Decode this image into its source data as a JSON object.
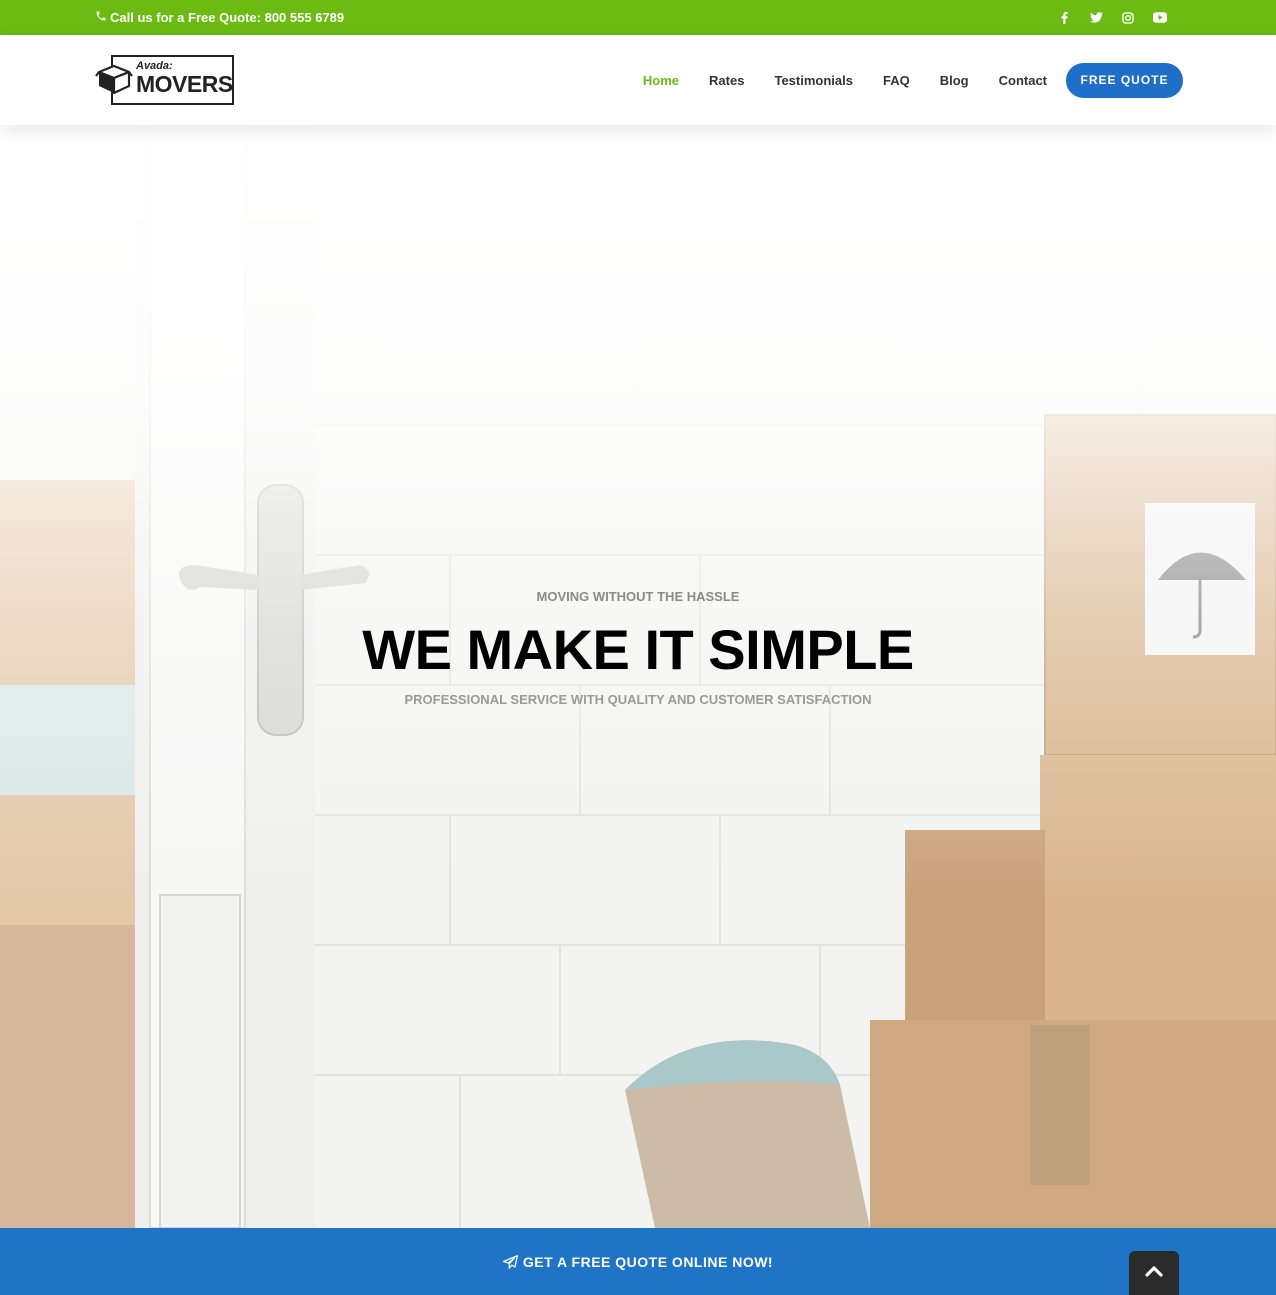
{
  "topbar": {
    "phone_text": "Call us for a Free Quote: 800 555 6789",
    "phone_icon": "phone-icon",
    "social": [
      "facebook-icon",
      "twitter-icon",
      "instagram-icon",
      "youtube-icon"
    ],
    "bg_color": "#6cbb13"
  },
  "logo": {
    "small": "Avada:",
    "big": "MOVERS",
    "icon": "box-icon"
  },
  "nav": {
    "items": [
      {
        "label": "Home",
        "active": true
      },
      {
        "label": "Rates"
      },
      {
        "label": "Testimonials"
      },
      {
        "label": "FAQ"
      },
      {
        "label": "Blog"
      },
      {
        "label": "Contact"
      }
    ],
    "cta_label": "FREE QUOTE",
    "active_color": "#6cbb13",
    "cta_color": "#1f6fc8"
  },
  "hero": {
    "kicker": "MOVING WITHOUT THE HASSLE",
    "headline": "WE MAKE IT SIMPLE",
    "sub": "PROFESSIONAL SERVICE WITH QUALITY AND CUSTOMER SATISFACTION"
  },
  "bottombar": {
    "label": "GET A FREE QUOTE ONLINE NOW!",
    "icon": "paper-plane-icon",
    "bg_color": "#1f74c6"
  },
  "scroll_top": {
    "icon": "chevron-up-icon"
  }
}
